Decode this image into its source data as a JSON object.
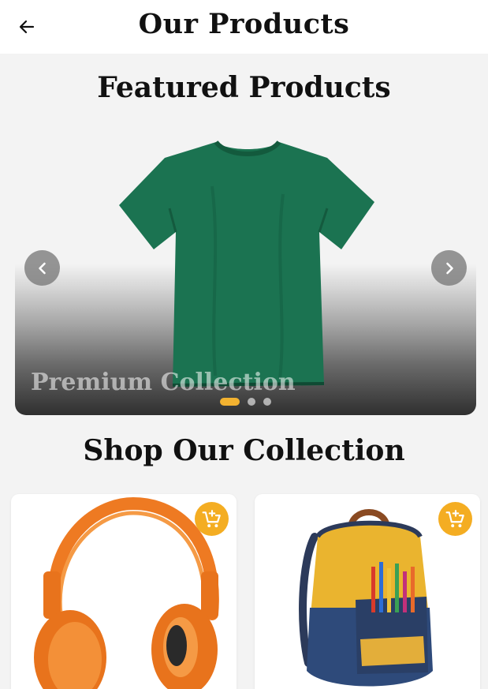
{
  "header": {
    "title": "Our Products",
    "back_icon": "arrow-left-icon"
  },
  "featured": {
    "title": "Featured Products",
    "slide": {
      "caption": "Premium Collection",
      "product": "green t-shirt"
    },
    "slide_count": 3,
    "active_slide": 1,
    "prev_icon": "chevron-left-icon",
    "next_icon": "chevron-right-icon"
  },
  "collection": {
    "title": "Shop Our Collection",
    "products": [
      {
        "image": "orange headphones",
        "cart_icon": "add-shopping-cart-icon"
      },
      {
        "image": "yellow and navy backpack",
        "cart_icon": "add-shopping-cart-icon"
      }
    ]
  },
  "colors": {
    "accent": "#F4AD22",
    "background": "#F3F3F3",
    "appbar": "#FFFFFF"
  }
}
